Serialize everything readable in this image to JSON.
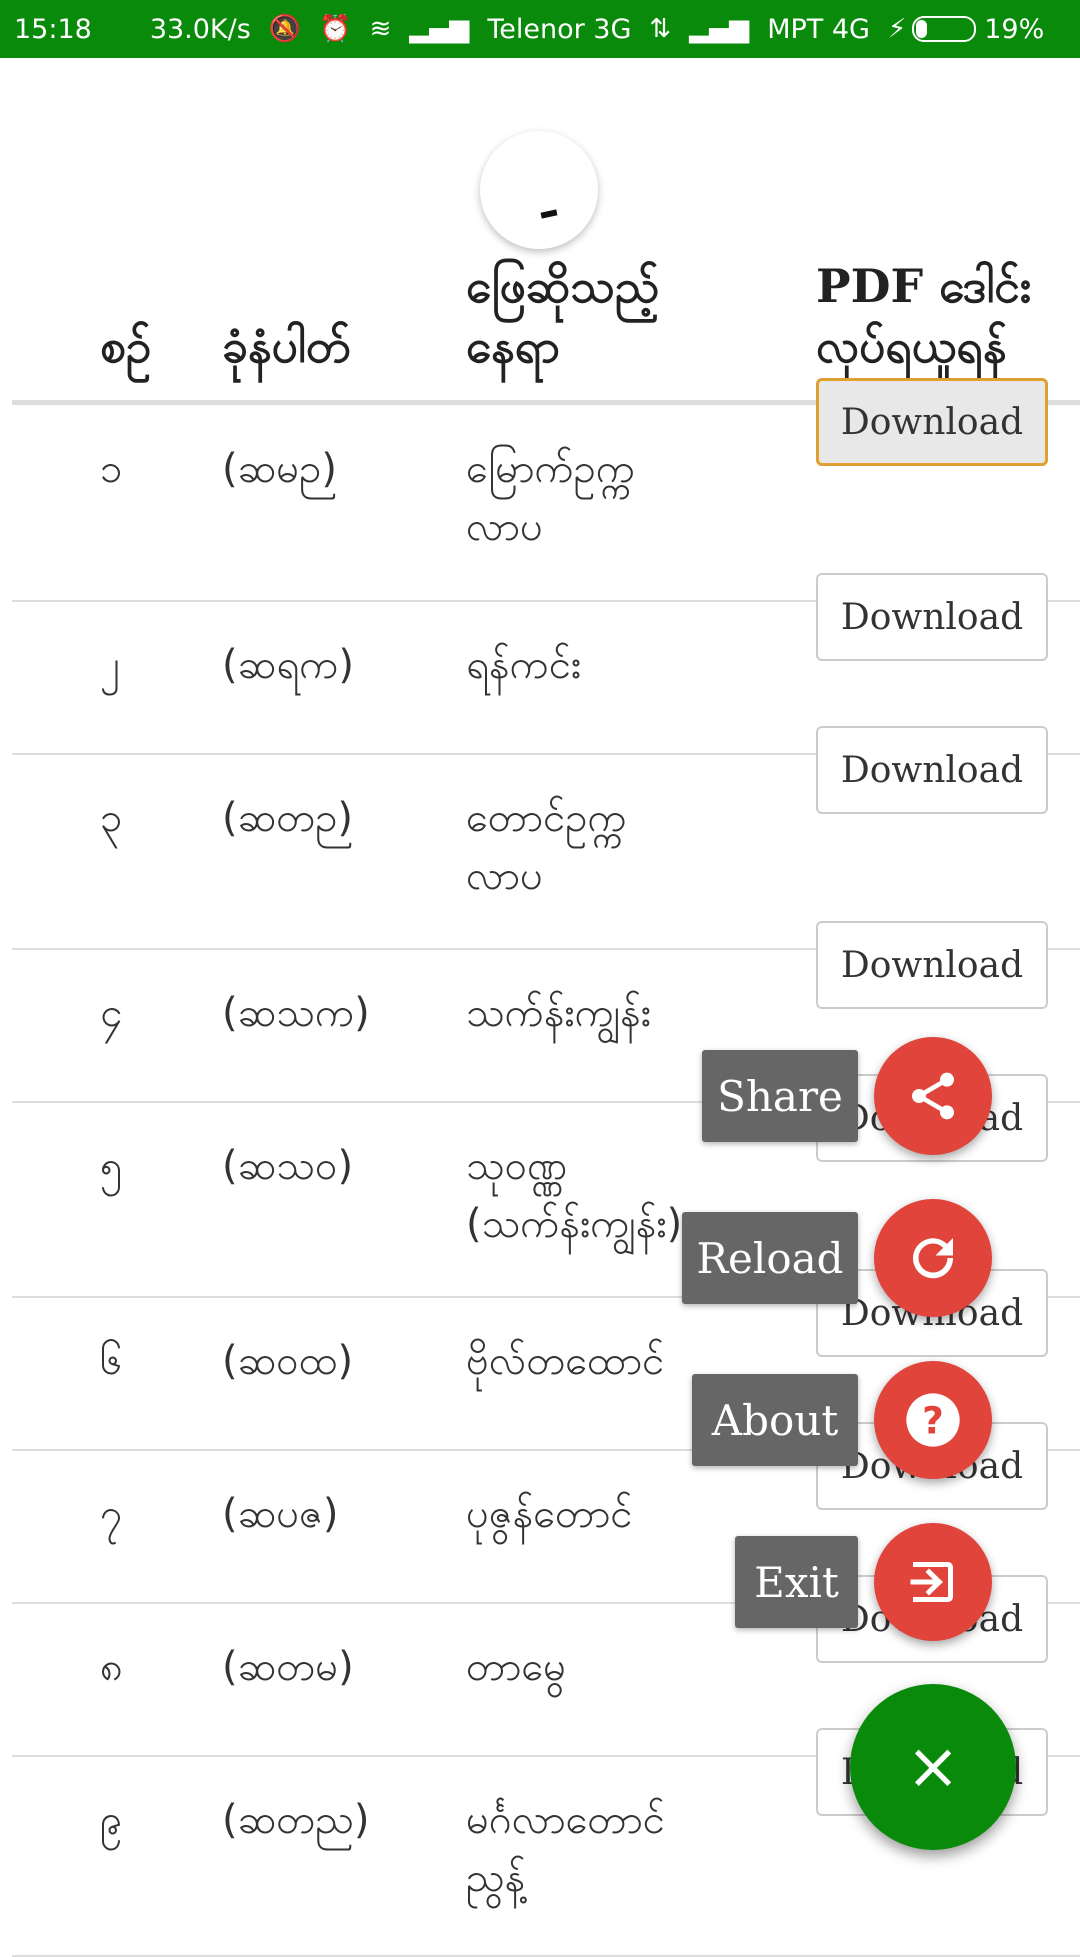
{
  "status_bar": {
    "time": "15:18",
    "speed": "33.0K/s",
    "carrier1": "Telenor 3G",
    "carrier2": "MPT 4G",
    "battery": "19%",
    "battery_level": 0.19
  },
  "table": {
    "headers": {
      "no": "စဉ်",
      "code": "ခုံနံပါတ်",
      "place_line1": "ဖြေဆိုသည့်",
      "place_line2": "နေရာ",
      "pdf_line1": "PDF ဒေါင်း",
      "pdf_line2": "လုပ်ရယူရန်"
    },
    "rows": [
      {
        "no": "၁",
        "code": "(ဆမဉ)",
        "place1": "မြောက်ဥက္က",
        "place2": "လာပ",
        "button": "Download"
      },
      {
        "no": "၂",
        "code": "(ဆရက)",
        "place1": "ရန်ကင်း",
        "place2": "",
        "button": "Download"
      },
      {
        "no": "၃",
        "code": "(ဆတဉ)",
        "place1": "တောင်ဥက္က",
        "place2": "လာပ",
        "button": "Download"
      },
      {
        "no": "၄",
        "code": "(ဆသက)",
        "place1": "သက်န်းကျွန်း",
        "place2": "",
        "button": "Download"
      },
      {
        "no": "၅",
        "code": "(ဆသ၀)",
        "place1": "သု၀ဏ္ဏ",
        "place2": "(သက်န်းကျွန်း)",
        "button": "Download"
      },
      {
        "no": "၆",
        "code": "(ဆ၀ထ)",
        "place1": "ဗိုလ်တထောင်",
        "place2": "",
        "button": "Download"
      },
      {
        "no": "၇",
        "code": "(ဆပဇ)",
        "place1": "ပုဇွန်တောင်",
        "place2": "",
        "button": "Download"
      },
      {
        "no": "၈",
        "code": "(ဆတမ)",
        "place1": "တာမွေ",
        "place2": "",
        "button": "Download"
      },
      {
        "no": "၉",
        "code": "(ဆတည)",
        "place1": "မင်္ဂလာတောင်",
        "place2": "ညွန့်",
        "button": "Download"
      }
    ]
  },
  "fab": {
    "share_label": "Share",
    "reload_label": "Reload",
    "about_label": "About",
    "exit_label": "Exit",
    "close_symbol": "×",
    "accent": "#e0443b",
    "main_color": "#0a8a0a"
  }
}
